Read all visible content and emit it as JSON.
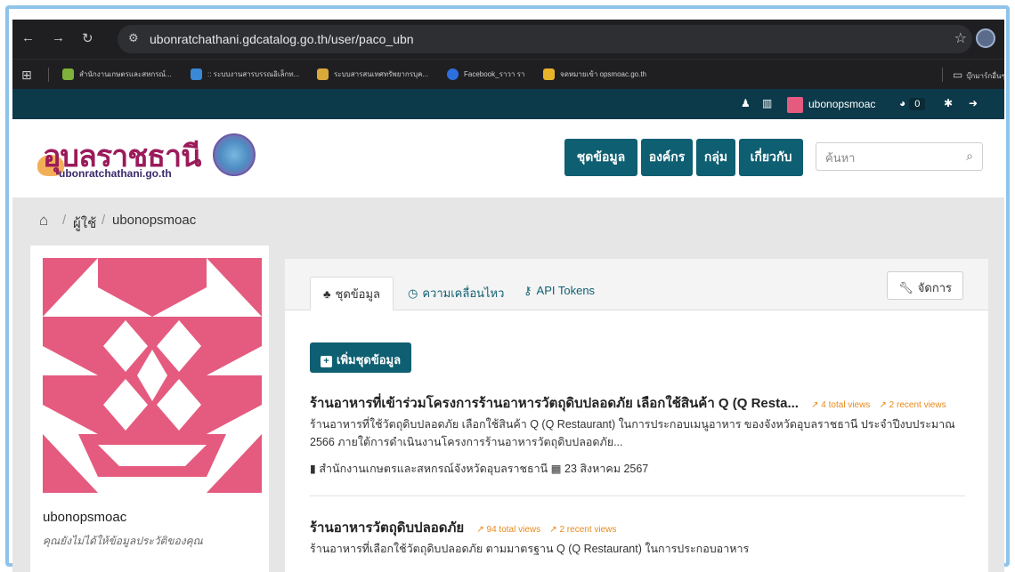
{
  "browser": {
    "url": "ubonratchathani.gdcatalog.go.th/user/paco_ubn",
    "bookmarks": [
      {
        "label": "สำนักงานเกษตรและสหกรณ์...",
        "color": "#7fb23a"
      },
      {
        "label": ":: ระบบงานสารบรรณอิเล็กท...",
        "color": "#3a89d6"
      },
      {
        "label": "ระบบสารสนเทศทรัพยากรบุค...",
        "color": "#d9a93a"
      },
      {
        "label": "Facebook_ราวา รา",
        "color": "#2e6fe0"
      },
      {
        "label": "จดหมายเข้า opsmoac.go.th",
        "color": "#e9b32a"
      }
    ],
    "other_bookmarks": "บุ๊กมาร์กอื่นๆ"
  },
  "topstrip": {
    "username": "ubonopsmoac",
    "badge_count": "0"
  },
  "header": {
    "logo_text": "อุบลราชธานี",
    "logo_sub": "ubonratchathani.go.th",
    "nav": [
      "ชุดข้อมูล",
      "องค์กร",
      "กลุ่ม",
      "เกี่ยวกับ"
    ],
    "search_placeholder": "ค้นหา"
  },
  "breadcrumb": {
    "items": [
      "ผู้ใช้",
      "ubonopsmoac"
    ]
  },
  "profile": {
    "username": "ubonopsmoac",
    "bio": "คุณยังไม่ได้ให้ข้อมูลประวัติของคุณ"
  },
  "tabs": {
    "datasets": "ชุดข้อมูล",
    "activity": "ความเคลื่อนไหว",
    "api": "API Tokens",
    "manage": "จัดการ"
  },
  "add_dataset_label": "เพิ่มชุดข้อมูล",
  "datasets": [
    {
      "title": "ร้านอาหารที่เข้าร่วมโครงการร้านอาหารวัตถุดิบปลอดภัย เลือกใช้สินค้า Q (Q Resta...",
      "total_views": "4 total views",
      "recent_views": "2 recent views",
      "desc": "ร้านอาหารที่ใช้วัตถุดิบปลอดภัย เลือกใช้สินค้า Q (Q Restaurant) ในการประกอบเมนูอาหาร ของจังหวัดอุบลราชธานี ประจำปีงบประมาณ 2566 ภายใต้การดำเนินงานโครงการร้านอาหารวัตถุดิบปลอดภัย...",
      "org": "สำนักงานเกษตรและสหกรณ์จังหวัดอุบลราชธานี",
      "date": "23 สิงหาคม 2567"
    },
    {
      "title": "ร้านอาหารวัตถุดิบปลอดภัย",
      "total_views": "94 total views",
      "recent_views": "2 recent views",
      "desc": "ร้านอาหารที่เลือกใช้วัตถุดิบปลอดภัย ตามมาตรฐาน Q (Q Restaurant) ในการประกอบอาหาร"
    }
  ],
  "colors": {
    "primary": "#0f5f72",
    "topstrip": "#0c3a4a",
    "identicon": "#e45b7f",
    "views": "#e88a1a"
  }
}
